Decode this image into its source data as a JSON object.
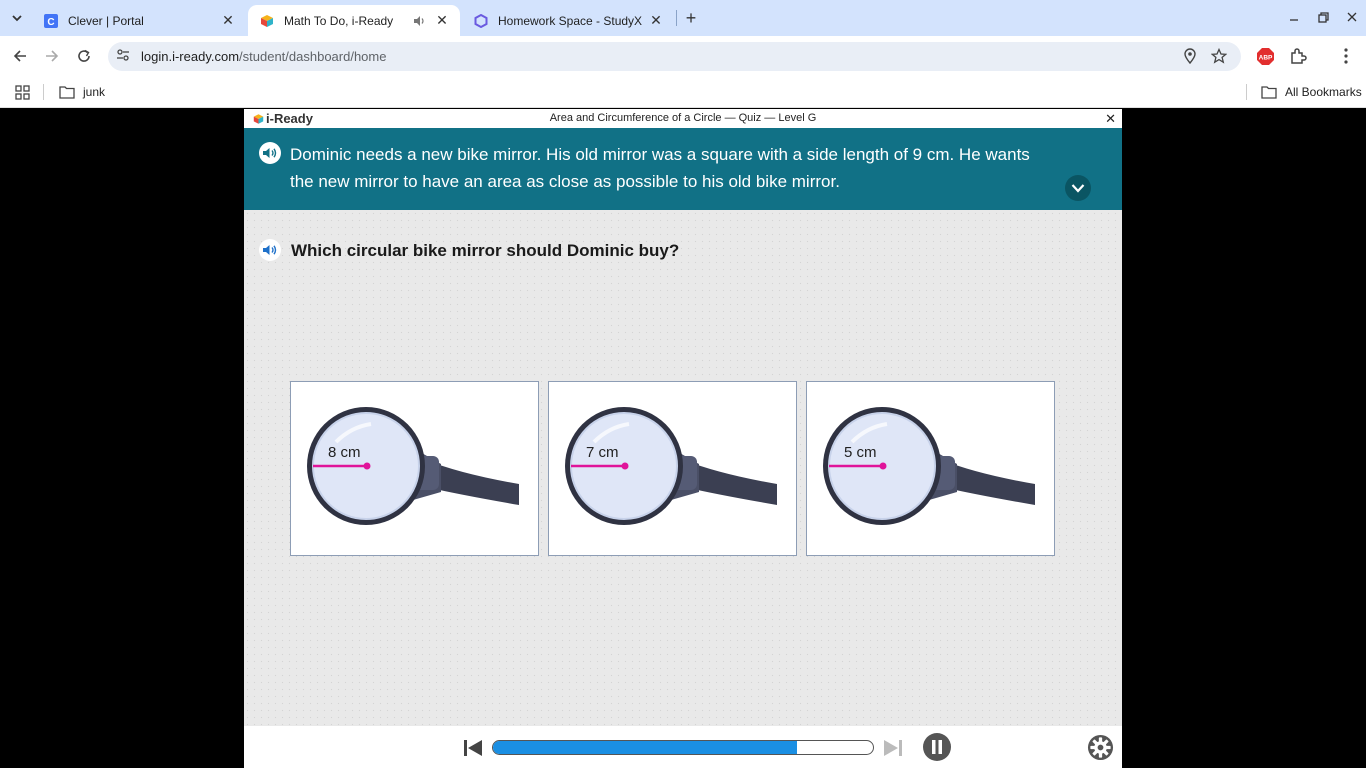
{
  "browser": {
    "tabs": [
      {
        "title": "Clever | Portal",
        "active": false
      },
      {
        "title": "Math To Do, i-Ready",
        "active": true
      },
      {
        "title": "Homework Space - StudyX",
        "active": false
      }
    ],
    "url_host": "login.i-ready.com",
    "url_path": "/student/dashboard/home",
    "bookmarks": [
      {
        "label": "junk"
      }
    ],
    "all_bookmarks_label": "All Bookmarks"
  },
  "app": {
    "logo_text": "i-Ready",
    "title": "Area and Circumference of a Circle — Quiz — Level G",
    "prompt_line1": "Dominic needs a new bike mirror. His old mirror was a square with a side length of 9 cm. He wants",
    "prompt_line2": "the new mirror to have an area as close as possible to his old bike mirror.",
    "question": "Which circular bike mirror should Dominic buy?",
    "choices": [
      {
        "radius_label": "8 cm"
      },
      {
        "radius_label": "7 cm"
      },
      {
        "radius_label": "5 cm"
      }
    ],
    "progress_fraction": 0.8,
    "colors": {
      "prompt_bg": "#117186",
      "progress": "#1a8fe3",
      "radius_line": "#e0149a"
    }
  }
}
